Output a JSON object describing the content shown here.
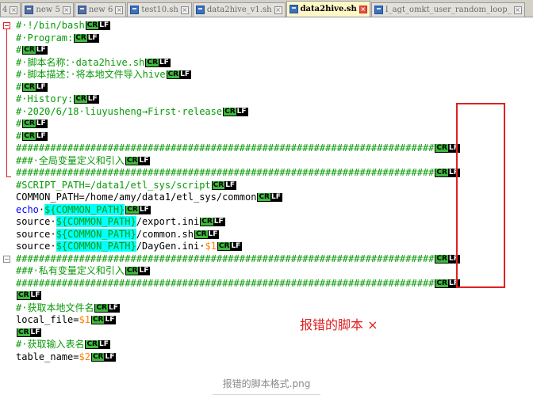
{
  "tabs": [
    {
      "label": "4",
      "icon": "document-icon",
      "active": false
    },
    {
      "label": "new 5",
      "icon": "disk-icon",
      "active": false
    },
    {
      "label": "new 6",
      "icon": "disk-icon",
      "active": false
    },
    {
      "label": "test10.sh",
      "icon": "document-icon",
      "active": false
    },
    {
      "label": "data2hive_v1.sh",
      "icon": "document-icon",
      "active": false
    },
    {
      "label": "data2hive.sh",
      "icon": "document-icon",
      "active": true
    },
    {
      "label": "I_agt_omkt_user_random_loop_",
      "icon": "document-icon",
      "active": false
    }
  ],
  "editor": {
    "lines": [
      [
        {
          "t": "#·!/bin/bash",
          "c": "c"
        },
        {
          "eol": true
        }
      ],
      [
        {
          "t": "#·Program:",
          "c": "c"
        },
        {
          "eol": true
        }
      ],
      [
        {
          "t": "#",
          "c": "c"
        },
        {
          "eol": true
        }
      ],
      [
        {
          "t": "#·脚本名称：·data2hive.sh",
          "c": "c"
        },
        {
          "eol": true
        }
      ],
      [
        {
          "t": "#·脚本描述：·将本地文件导入hive",
          "c": "c"
        },
        {
          "eol": true
        }
      ],
      [
        {
          "t": "#",
          "c": "c"
        },
        {
          "eol": true
        }
      ],
      [
        {
          "t": "#·History:",
          "c": "c"
        },
        {
          "eol": true
        }
      ],
      [
        {
          "t": "#·2020/6/18·liuyusheng→First·release",
          "c": "c"
        },
        {
          "eol": true
        }
      ],
      [
        {
          "t": "#",
          "c": "c"
        },
        {
          "eol": true
        }
      ],
      [
        {
          "t": "#",
          "c": "c"
        },
        {
          "eol": true
        }
      ],
      [
        {
          "t": "#########################################################################",
          "c": "c"
        },
        {
          "eol": true
        }
      ],
      [
        {
          "t": "###·全局变量定义和引入",
          "c": "c"
        },
        {
          "eol": true
        }
      ],
      [
        {
          "t": "#########################################################################",
          "c": "c"
        },
        {
          "eol": true
        }
      ],
      [
        {
          "t": "#SCRIPT_PATH=/data1/etl_sys/script",
          "c": "c"
        },
        {
          "eol": true
        }
      ],
      [
        {
          "t": "COMMON_PATH=/home/amy/data1/etl_sys/common",
          "c": "d"
        },
        {
          "eol": true
        }
      ],
      [
        {
          "t": "echo",
          "c": "k"
        },
        {
          "t": "·",
          "c": "d"
        },
        {
          "t": "${COMMON_PATH}",
          "c": "v"
        },
        {
          "eol": true
        }
      ],
      [
        {
          "t": "source·",
          "c": "d"
        },
        {
          "t": "${COMMON_PATH}",
          "c": "v"
        },
        {
          "t": "/export.ini",
          "c": "d"
        },
        {
          "eol": true
        }
      ],
      [
        {
          "t": "source·",
          "c": "d"
        },
        {
          "t": "${COMMON_PATH}",
          "c": "v"
        },
        {
          "t": "/common.sh",
          "c": "d"
        },
        {
          "eol": true
        }
      ],
      [
        {
          "t": "source·",
          "c": "d"
        },
        {
          "t": "${COMMON_PATH}",
          "c": "v"
        },
        {
          "t": "/DayGen.ini·",
          "c": "d"
        },
        {
          "t": "$1",
          "c": "n"
        },
        {
          "eol": true
        }
      ],
      [
        {
          "t": "#########################################################################",
          "c": "c"
        },
        {
          "eol": true
        }
      ],
      [
        {
          "t": "###·私有变量定义和引入",
          "c": "c"
        },
        {
          "eol": true
        }
      ],
      [
        {
          "t": "#########################################################################",
          "c": "c"
        },
        {
          "eol": true
        }
      ],
      [
        {
          "eol": true
        }
      ],
      [
        {
          "t": "#·获取本地文件名",
          "c": "c"
        },
        {
          "eol": true
        }
      ],
      [
        {
          "t": "local_file=",
          "c": "d"
        },
        {
          "t": "$1",
          "c": "n"
        },
        {
          "eol": true
        }
      ],
      [
        {
          "eol": true
        }
      ],
      [
        {
          "t": "#·获取输入表名",
          "c": "c"
        },
        {
          "eol": true
        }
      ],
      [
        {
          "t": "table_name=",
          "c": "d"
        },
        {
          "t": "$2",
          "c": "n"
        },
        {
          "eol": true
        }
      ]
    ],
    "eol_cr": "CR",
    "eol_lf": "LF"
  },
  "annotation": {
    "note": "报错的脚本 ×"
  },
  "caption": "报错的脚本格式.png",
  "colors": {
    "comment": "#0a9a0a",
    "keyword": "#0000ff",
    "variable_bg": "#00ffff",
    "number": "#ff8000",
    "annotation": "#e02020",
    "cr_bg": "#3db83d"
  }
}
